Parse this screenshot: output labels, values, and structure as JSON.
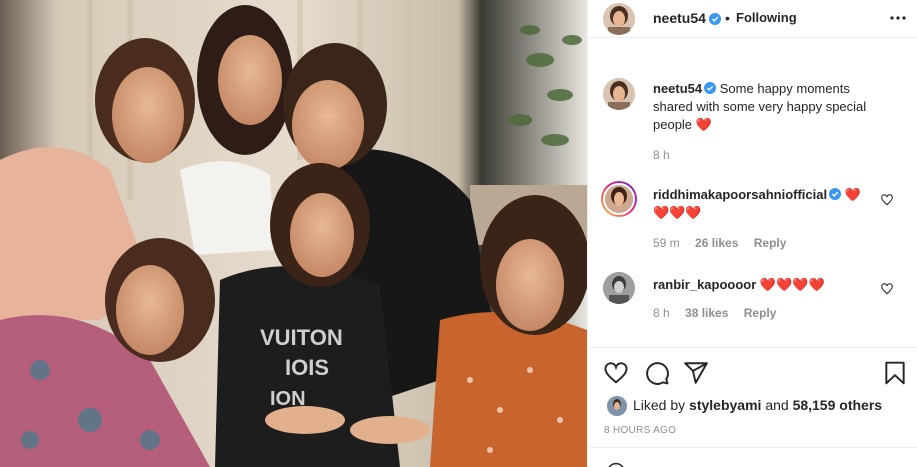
{
  "post": {
    "photo_alt": "",
    "photo_shirt_text": [
      "VUITON",
      "IOIS",
      "ION"
    ]
  },
  "header": {
    "username": "neetu54",
    "separator": "•",
    "follow_state": "Following"
  },
  "caption": {
    "username": "neetu54",
    "text": "Some happy moments shared with some very happy special people ❤️️",
    "time": "8 h"
  },
  "comments": [
    {
      "username": "riddhimakapoorsahniofficial",
      "text": "❤️ ❤️❤️❤️",
      "time": "59 m",
      "likes": "26 likes",
      "reply": "Reply"
    },
    {
      "username": "ranbir_kapoooor",
      "text": "❤️❤️❤️❤️",
      "time": "8 h",
      "likes": "38 likes",
      "reply": "Reply"
    }
  ],
  "likes": {
    "prefix": "Liked by",
    "first_user": "stylebyami",
    "connector": "and",
    "others": "58,159 others"
  },
  "timestamp": "8 HOURS AGO",
  "colors": {
    "verified": "#3897f0",
    "muted": "#8e8e8e",
    "text": "#262626",
    "border": "#efefef"
  },
  "icons": [
    "verified-icon",
    "more-icon",
    "heart-icon",
    "comment-icon",
    "share-icon",
    "save-icon",
    "emoji-icon"
  ]
}
